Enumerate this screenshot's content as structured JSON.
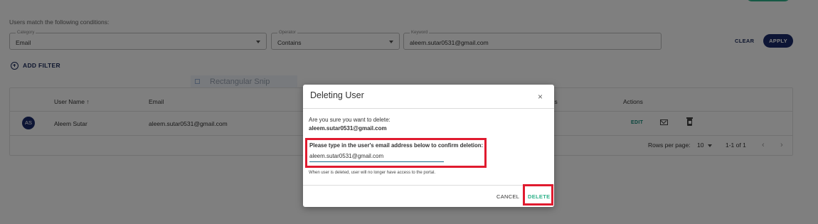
{
  "filters": {
    "heading": "Users match the following conditions:",
    "category": {
      "label": "Category",
      "value": "Email"
    },
    "operator": {
      "label": "Operator",
      "value": "Contains"
    },
    "keyword": {
      "label": "Keyword",
      "value": "aleem.sutar0531@gmail.com"
    },
    "clear_label": "CLEAR",
    "apply_label": "APPLY",
    "add_filter_label": "ADD FILTER"
  },
  "snip_tool": {
    "label": "Rectangular Snip"
  },
  "table": {
    "headers": {
      "user_name": "User Name ↑",
      "email": "Email",
      "permissions": "ons",
      "actions": "Actions"
    },
    "rows": [
      {
        "initials": "AS",
        "name": "Aleem Sutar",
        "email": "aleem.sutar0531@gmail.com",
        "edit_label": "EDIT"
      }
    ],
    "footer": {
      "rows_per_page_label": "Rows per page:",
      "rows_per_page_value": "10",
      "range": "1-1 of 1"
    }
  },
  "modal": {
    "title": "Deleting User",
    "close_glyph": "×",
    "question": "Are you sure you want to delete:",
    "target_email": "aleem.sutar0531@gmail.com",
    "instruction": "Please type in the user's email address below to confirm deletion:",
    "input_value": "aleem.sutar0531@gmail.com",
    "note": "When user is deleted, user will no longer have access to the portal.",
    "cancel_label": "CANCEL",
    "delete_label": "DELETE"
  },
  "colors": {
    "primary": "#1b2a6b",
    "accent": "#2fb28a",
    "highlight": "#e01b2f"
  }
}
